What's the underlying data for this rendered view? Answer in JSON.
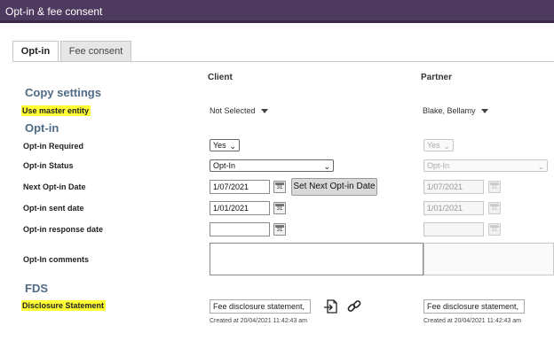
{
  "window": {
    "title": "Opt-in & fee consent"
  },
  "tabs": [
    {
      "label": "Opt-in"
    },
    {
      "label": "Fee consent"
    }
  ],
  "columns": {
    "client": "Client",
    "partner": "Partner"
  },
  "sections": {
    "copy_settings": "Copy settings",
    "opt_in": "Opt-in",
    "fds": "FDS"
  },
  "labels": {
    "use_master_entity": "Use master entity",
    "opt_in_required": "Opt-in Required",
    "opt_in_status": "Opt-in Status",
    "next_opt_in_date": "Next Opt-in Date",
    "opt_in_sent_date": "Opt-in sent date",
    "opt_in_response_date": "Opt-in response date",
    "opt_in_comments": "Opt-In comments",
    "disclosure_statement": "Disclosure Statement"
  },
  "client": {
    "master_entity": "Not Selected",
    "opt_in_required": "Yes",
    "opt_in_status": "Opt-In",
    "next_opt_in_date": "1/07/2021",
    "set_next_button": "Set Next Opt-in Date",
    "opt_in_sent_date": "1/01/2021",
    "opt_in_response_date": "",
    "fee_disclosure": "Fee disclosure statement,",
    "created": "Created at 20/04/2021 11:42:43 am"
  },
  "partner": {
    "master_entity": "Blake, Bellamy",
    "opt_in_required": "Yes",
    "opt_in_status": "Opt-In",
    "next_opt_in_date": "1/07/2021",
    "opt_in_sent_date": "1/01/2021",
    "opt_in_response_date": "",
    "fee_disclosure": "Fee disclosure statement,",
    "created": "Created at 20/04/2021 11:42:43 am"
  },
  "calendar_icon_text": "31",
  "colors": {
    "titlebar": "#4e3a5e",
    "section_heading": "#4f6b85",
    "highlight": "#ffff33"
  },
  "icons": {
    "open_document": "open-document-icon",
    "link": "link-icon",
    "calendar": "calendar-icon"
  }
}
